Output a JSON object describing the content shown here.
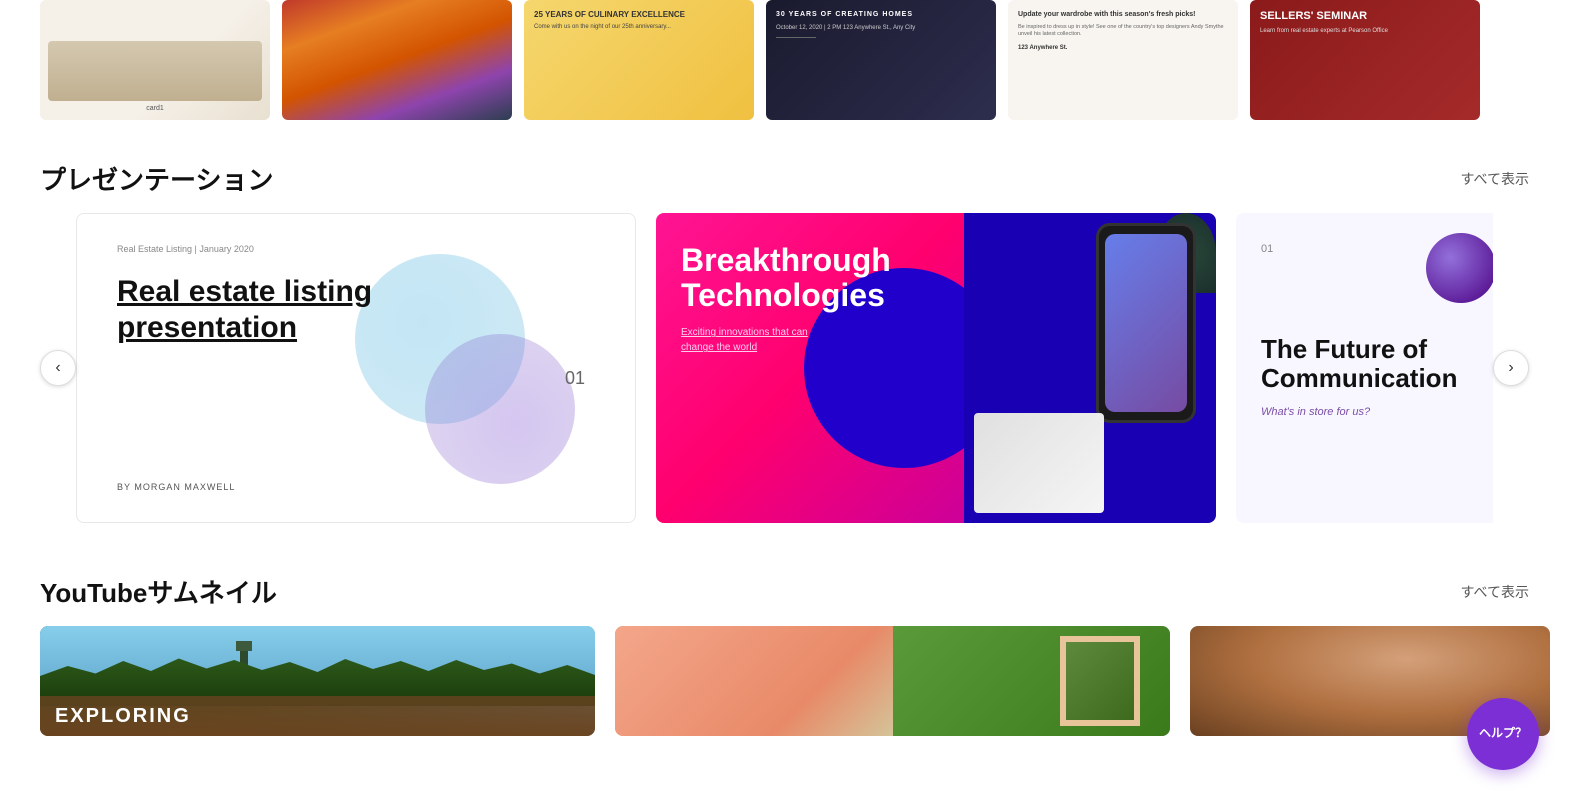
{
  "top_cards": [
    {
      "id": "card1",
      "type": "living_room"
    },
    {
      "id": "card2",
      "type": "aerial_city"
    },
    {
      "id": "card3",
      "type": "culinary",
      "title": "25 YEARS OF CULINARY EXCELLENCE",
      "body": "Come with us on the night of our 25th anniversary..."
    },
    {
      "id": "card4",
      "type": "homes",
      "title": "30 YEARS OF CREATING HOMES",
      "date": "October 12, 2020 | 2 PM\n123 Anywhere St., Any City"
    },
    {
      "id": "card5",
      "type": "fashion",
      "title": "Update your wardrobe with this season's fresh picks!",
      "addr": "123 Anywhere St."
    },
    {
      "id": "card6",
      "type": "seminar",
      "title": "SELLERS' SEMINAR",
      "body": "Learn from real estate experts at Pearson Office"
    }
  ],
  "presentation_section": {
    "title": "プレゼンテーション",
    "view_all": "すべて表示",
    "arrow_left": "‹",
    "arrow_right": "›",
    "cards": [
      {
        "id": "pres1",
        "type": "real_estate",
        "small_text": "Real Estate Listing | January 2020",
        "number": "01",
        "main_title": "Real estate listing presentation",
        "author": "BY MORGAN MAXWELL"
      },
      {
        "id": "pres2",
        "type": "breakthrough",
        "title": "Breakthrough Technologies",
        "subtitle_line1": "Exciting innovations that can",
        "subtitle_line2": "change the world"
      },
      {
        "id": "pres3",
        "type": "future_comm",
        "number": "01",
        "title": "The Future of Communication",
        "subtitle": "What's in store for us?"
      }
    ]
  },
  "youtube_section": {
    "title": "YouTubeサムネイル",
    "view_all": "すべて表示",
    "cards": [
      {
        "id": "yt1",
        "title": "EXPLORING"
      },
      {
        "id": "yt2",
        "title": ""
      },
      {
        "id": "yt3",
        "title": ""
      }
    ]
  },
  "help_button": {
    "label": "ヘルプ？"
  }
}
